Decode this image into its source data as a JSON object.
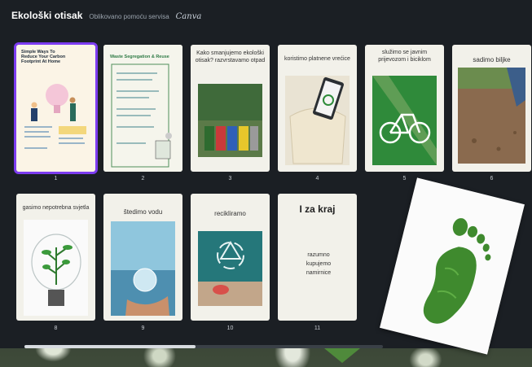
{
  "header": {
    "title": "Ekološki otisak",
    "subtitle": "Oblikovano pomoću servisa",
    "brand": "Canva"
  },
  "slides": [
    {
      "num": "1",
      "title": "Simple Ways To Reduce Your Carbon Footprint At Home"
    },
    {
      "num": "2",
      "title": "Waste Segregation & Reuse"
    },
    {
      "num": "3",
      "caption": "Kako smanjujemo ekološki otisak? razvrstavamo otpad"
    },
    {
      "num": "4",
      "caption": "koristimo platnene vrećice"
    },
    {
      "num": "5",
      "caption": "služimo se javnim prijevozom i biciklom"
    },
    {
      "num": "6",
      "caption": "sadimo biljke"
    },
    {
      "num": "8",
      "caption": "gasimo nepotrebna svjetla"
    },
    {
      "num": "9",
      "caption": "štedimo vodu"
    },
    {
      "num": "10",
      "caption": "recikliramo"
    },
    {
      "num": "11",
      "title": "I za kraj",
      "caption": "razumno kupujemo namirnice"
    }
  ],
  "colors": {
    "panel": "#1b1f24",
    "selected": "#7d3cf0",
    "green": "#2e8b3a"
  }
}
